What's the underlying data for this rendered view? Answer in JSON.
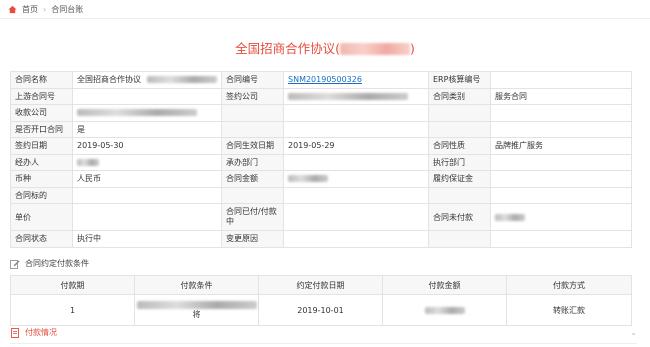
{
  "breadcrumb": {
    "home": "首页",
    "current": "合同台账"
  },
  "title": "全国招商合作协议",
  "info_rows": [
    [
      {
        "label": "合同名称",
        "value": "全国招商合作协议",
        "blur": 70
      },
      {
        "label": "合同编号",
        "value": "SNM20190500326",
        "link": true
      },
      {
        "label": "ERP核算编号",
        "value": ""
      }
    ],
    [
      {
        "label": "上游合同号",
        "value": ""
      },
      {
        "label": "签约公司",
        "value": "",
        "blur": 120
      },
      {
        "label": "合同类别",
        "value": "服务合同"
      }
    ],
    [
      {
        "label": "收款公司",
        "value": "",
        "blur": 120
      },
      {
        "label": "",
        "value": ""
      },
      {
        "label": "",
        "value": ""
      }
    ],
    [
      {
        "label": "是否开口合同",
        "value": "是"
      },
      {
        "label": "",
        "value": ""
      },
      {
        "label": "",
        "value": ""
      }
    ],
    [
      {
        "label": "签约日期",
        "value": "2019-05-30"
      },
      {
        "label": "合同生效日期",
        "value": "2019-05-29"
      },
      {
        "label": "合同性质",
        "value": "品牌推广服务"
      }
    ],
    [
      {
        "label": "经办人",
        "value": "",
        "blur": 22
      },
      {
        "label": "承办部门",
        "value": ""
      },
      {
        "label": "执行部门",
        "value": ""
      }
    ],
    [
      {
        "label": "币种",
        "value": "人民币"
      },
      {
        "label": "合同金额",
        "value": "",
        "blur": 40
      },
      {
        "label": "履约保证金",
        "value": ""
      }
    ],
    [
      {
        "label": "合同标的",
        "value": ""
      },
      {
        "label": "",
        "value": ""
      },
      {
        "label": "",
        "value": ""
      }
    ],
    [
      {
        "label": "单价",
        "value": ""
      },
      {
        "label": "合同已付/付款中",
        "value": ""
      },
      {
        "label": "合同未付款",
        "value": "",
        "blur": 30
      }
    ],
    [
      {
        "label": "合同状态",
        "value": "执行中"
      },
      {
        "label": "变更原因",
        "value": ""
      },
      {
        "label": "",
        "value": ""
      }
    ]
  ],
  "payment_section": {
    "title": "合同约定付款条件"
  },
  "payment_table": {
    "headers": [
      "付款期",
      "付款条件",
      "约定付款日期",
      "付款金额",
      "付款方式"
    ],
    "rows": [
      [
        "1",
        "",
        "2019-10-01",
        "",
        "转账汇款"
      ]
    ],
    "condition_tail": "将"
  },
  "section2": {
    "title": "付款情况"
  }
}
